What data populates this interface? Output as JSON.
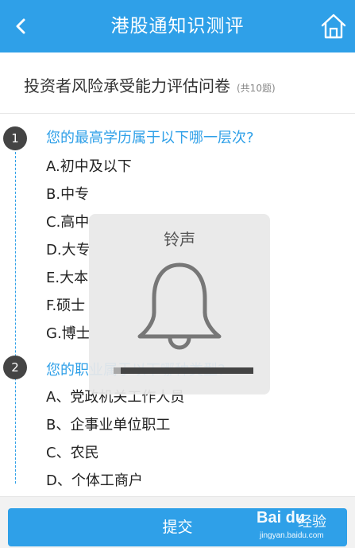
{
  "header": {
    "title": "港股通知识测评",
    "back_icon": "chevron-left-icon",
    "home_icon": "home-icon"
  },
  "subtitle": {
    "text": "投资者风险承受能力评估问卷",
    "count": "(共10题)"
  },
  "questions": [
    {
      "number": "1",
      "title": "您的最高学历属于以下哪一层次?",
      "options": [
        "A.初中及以下",
        "B.中专",
        "C.高中",
        "D.大专",
        "E.大本",
        "F.硕士",
        "G.博士"
      ]
    },
    {
      "number": "2",
      "title": "您的职业属于以下哪种类型?",
      "options": [
        "A、党政机关工作人员",
        "B、企事业单位职工",
        "C、农民",
        "D、个体工商户"
      ]
    }
  ],
  "popup": {
    "title": "铃声",
    "icon": "bell-icon",
    "volume_fraction": 0.05
  },
  "footer": {
    "submit_label": "提交"
  },
  "watermark": {
    "logo": "Bai du",
    "text": "经验",
    "url": "jingyan.baidu.com"
  },
  "colors": {
    "accent": "#2fa0e8",
    "badge": "#444444"
  }
}
